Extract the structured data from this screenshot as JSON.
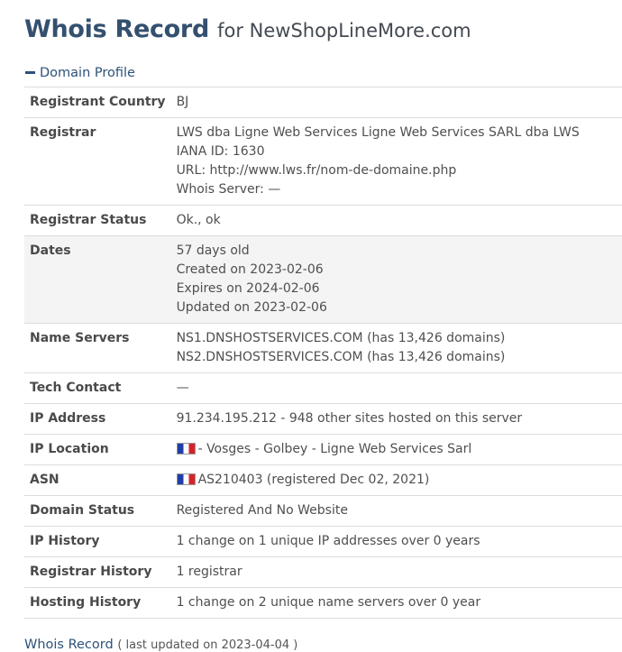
{
  "header": {
    "title_main": "Whois Record",
    "title_for": "for NewShopLineMore.com"
  },
  "section": {
    "label": "Domain Profile"
  },
  "rows": {
    "registrant_country": {
      "label": "Registrant Country",
      "value": "BJ"
    },
    "registrar": {
      "label": "Registrar",
      "lines": [
        "LWS dba Ligne Web Services Ligne Web Services SARL dba LWS",
        "IANA ID: 1630",
        "URL: http://www.lws.fr/nom-de-domaine.php",
        "Whois Server: —"
      ]
    },
    "registrar_status": {
      "label": "Registrar Status",
      "value": "Ok., ok"
    },
    "dates": {
      "label": "Dates",
      "lines": [
        "57 days old",
        "Created on 2023-02-06",
        "Expires on 2024-02-06",
        "Updated on 2023-02-06"
      ]
    },
    "name_servers": {
      "label": "Name Servers",
      "lines": [
        "NS1.DNSHOSTSERVICES.COM (has 13,426 domains)",
        "NS2.DNSHOSTSERVICES.COM (has 13,426 domains)"
      ]
    },
    "tech_contact": {
      "label": "Tech Contact",
      "value": "—"
    },
    "ip_address": {
      "label": "IP Address",
      "value": "91.234.195.212 - 948 other sites hosted on this server"
    },
    "ip_location": {
      "label": "IP Location",
      "value": "- Vosges - Golbey - Ligne Web Services Sarl",
      "flag": "france-flag-icon"
    },
    "asn": {
      "label": "ASN",
      "value": "AS210403 (registered Dec 02, 2021)",
      "flag": "france-flag-icon"
    },
    "domain_status": {
      "label": "Domain Status",
      "value": "Registered And No Website"
    },
    "ip_history": {
      "label": "IP History",
      "value": "1 change on 1 unique IP addresses over 0 years"
    },
    "registrar_history": {
      "label": "Registrar History",
      "value": "1 registrar"
    },
    "hosting_history": {
      "label": "Hosting History",
      "value": "1 change on 2 unique name servers over 0 year"
    }
  },
  "footer": {
    "label": "Whois Record",
    "updated": "( last updated on 2023-04-04 )"
  },
  "colors": {
    "title": "#34506f",
    "link": "#2d5279",
    "row_shade": "#f4f4f4",
    "border": "#dcdcdc"
  }
}
